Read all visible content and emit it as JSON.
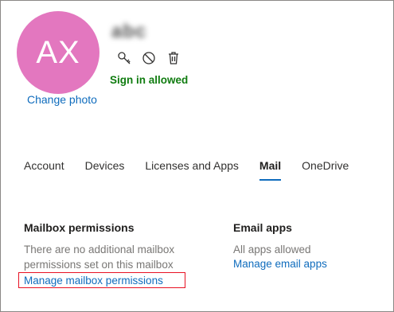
{
  "profile": {
    "initials": "AX",
    "name": "abc",
    "change_photo": "Change photo",
    "status": "Sign in allowed",
    "action_icons": [
      "key-icon",
      "block-icon",
      "trash-icon"
    ]
  },
  "tabs": [
    {
      "label": "Account"
    },
    {
      "label": "Devices"
    },
    {
      "label": "Licenses and Apps"
    },
    {
      "label": "Mail",
      "active": true
    },
    {
      "label": "OneDrive"
    }
  ],
  "mailbox_permissions": {
    "title": "Mailbox permissions",
    "description_line1": "There are no additional mailbox",
    "description_line2": "permissions set on this mailbox",
    "link": "Manage mailbox permissions"
  },
  "email_apps": {
    "title": "Email apps",
    "description": "All apps allowed",
    "link": "Manage email apps"
  },
  "colors": {
    "avatar": "#e377bf",
    "link": "#0f6cbd",
    "status": "#107c10",
    "highlight": "#e81123"
  }
}
